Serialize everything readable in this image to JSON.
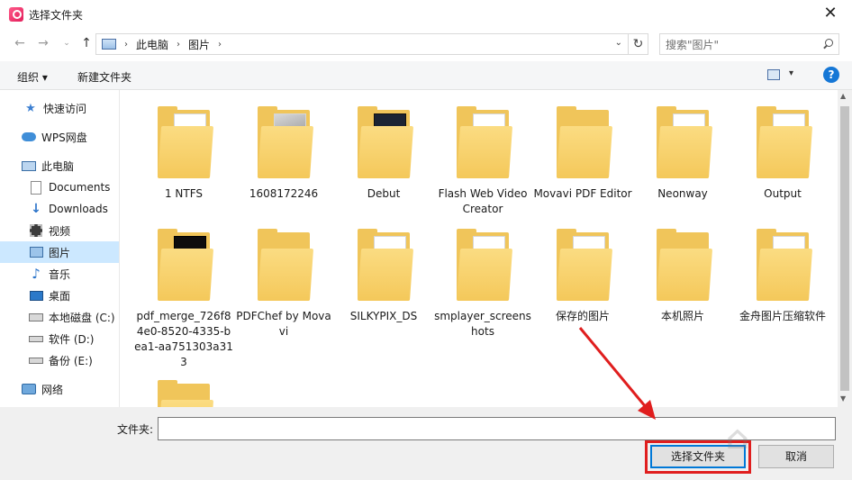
{
  "window": {
    "title": "选择文件夹"
  },
  "addressbar": {
    "breadcrumbs": [
      "此电脑",
      "图片"
    ],
    "search_placeholder": "搜索\"图片\""
  },
  "toolbar": {
    "organize": "组织 ▾",
    "new_folder": "新建文件夹",
    "help": "?"
  },
  "sidebar": {
    "items": [
      {
        "label": "快速访问",
        "icon": "star-icon"
      },
      {
        "label": "WPS网盘",
        "icon": "cloud-icon"
      },
      {
        "label": "此电脑",
        "icon": "computer-icon"
      },
      {
        "label": "Documents",
        "icon": "document-icon"
      },
      {
        "label": "Downloads",
        "icon": "download-icon"
      },
      {
        "label": "视频",
        "icon": "video-icon"
      },
      {
        "label": "图片",
        "icon": "pictures-icon",
        "selected": true
      },
      {
        "label": "音乐",
        "icon": "music-icon"
      },
      {
        "label": "桌面",
        "icon": "desktop-icon"
      },
      {
        "label": "本地磁盘 (C:)",
        "icon": "drive-icon"
      },
      {
        "label": "软件 (D:)",
        "icon": "drive-icon"
      },
      {
        "label": "备份 (E:)",
        "icon": "drive-icon"
      },
      {
        "label": "网络",
        "icon": "network-icon"
      }
    ]
  },
  "folders": [
    {
      "label": "1 NTFS",
      "preview": "doc"
    },
    {
      "label": "1608172246",
      "preview": "photo"
    },
    {
      "label": "Debut",
      "preview": "dark"
    },
    {
      "label": "Flash Web Video Creator",
      "preview": "doc"
    },
    {
      "label": "Movavi PDF Editor",
      "preview": "none"
    },
    {
      "label": "Neonway",
      "preview": "doc"
    },
    {
      "label": "Output",
      "preview": "small-doc"
    },
    {
      "label": "pdf_merge_726f84e0-8520-4335-bea1-aa751303a313",
      "preview": "black"
    },
    {
      "label": "PDFChef by Movavi",
      "preview": "none"
    },
    {
      "label": "SILKYPIX_DS",
      "preview": "small-doc"
    },
    {
      "label": "smplayer_screenshots",
      "preview": "doc"
    },
    {
      "label": "保存的图片",
      "preview": "berry"
    },
    {
      "label": "本机照片",
      "preview": "none"
    },
    {
      "label": "金舟图片压缩软件",
      "preview": "berry"
    },
    {
      "label": "",
      "preview": "none"
    }
  ],
  "footer": {
    "folder_label": "文件夹:",
    "folder_value": "",
    "select_button": "选择文件夹",
    "cancel_button": "取消"
  },
  "colors": {
    "accent": "#0078d7",
    "highlight": "#e01e1e",
    "selection": "#cce8ff"
  }
}
